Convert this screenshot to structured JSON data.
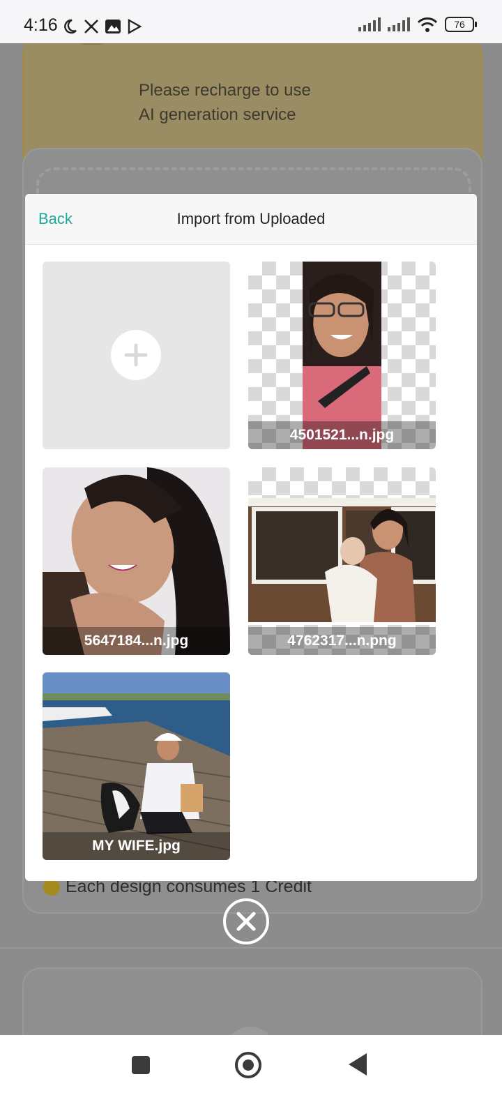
{
  "status_bar": {
    "time": "4:16",
    "battery": "76",
    "left_icons": [
      "moon-icon",
      "x-logo-icon",
      "gallery-icon",
      "play-store-icon"
    ],
    "right_icons": [
      "signal-icon",
      "signal-icon",
      "wifi-icon",
      "battery-icon"
    ]
  },
  "background": {
    "warning_text": "Please recharge to use AI generation service",
    "credit_note": "Each design consumes 1 Credit"
  },
  "dialog": {
    "back_label": "Back",
    "title": "Import from Uploaded",
    "add_icon": "plus-icon",
    "items": [
      {
        "label": "4501521...n.jpg"
      },
      {
        "label": "5647184...n.jpg"
      },
      {
        "label": "4762317...n.png"
      },
      {
        "label": "MY WIFE.jpg"
      }
    ]
  },
  "close_icon": "close-circle-icon",
  "nav": {
    "buttons": [
      "recents-button",
      "home-button",
      "back-button"
    ]
  },
  "colors": {
    "accent": "#1ea79e",
    "warning_card": "#f0c258"
  }
}
